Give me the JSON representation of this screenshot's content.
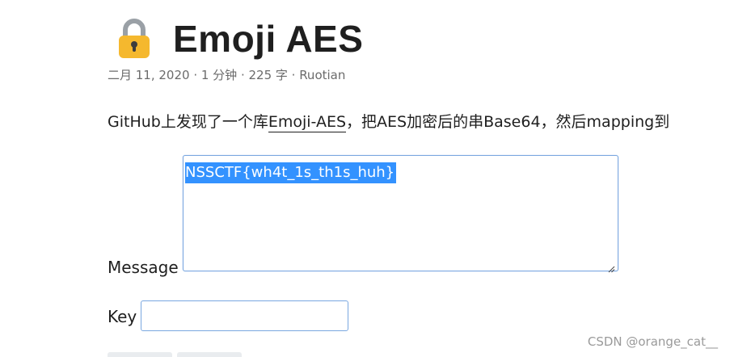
{
  "post": {
    "icon": "lock-emoji-icon",
    "title": "Emoji AES",
    "meta": "二月 11, 2020 · 1 分钟 · 225 字 · Ruotian",
    "intro_before": "GitHub上发现了一个库",
    "intro_link": "Emoji-AES",
    "intro_after": "，把AES加密后的串Base64，然后mapping到"
  },
  "form": {
    "message_label": "Message",
    "message_value": "NSSCTF{wh4t_1s_th1s_huh}",
    "key_label": "Key",
    "key_value": "",
    "buttons": [
      "",
      ""
    ]
  },
  "watermark": "CSDN @orange_cat__",
  "colors": {
    "selection": "#3392ff",
    "input_border": "#7aa7e0",
    "lock_body": "#f5b82e",
    "lock_shackle": "#9aa0a6"
  }
}
